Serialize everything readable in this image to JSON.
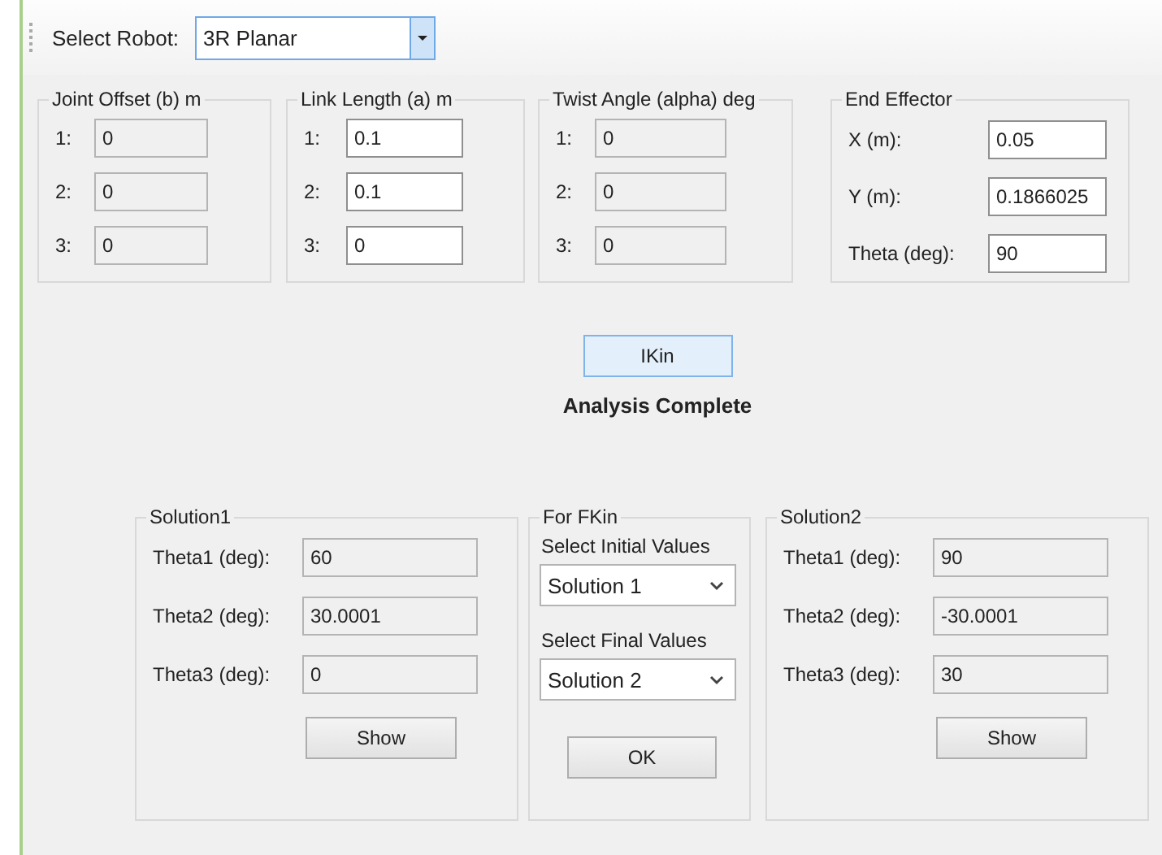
{
  "toolbar": {
    "label": "Select Robot:",
    "robot_select": {
      "value": "3R Planar"
    }
  },
  "parameter_groups": [
    {
      "title": "Joint Offset (b) m",
      "rows": [
        {
          "label": "1:",
          "value": "0",
          "disabled": true
        },
        {
          "label": "2:",
          "value": "0",
          "disabled": true
        },
        {
          "label": "3:",
          "value": "0",
          "disabled": true
        }
      ]
    },
    {
      "title": "Link Length (a) m",
      "rows": [
        {
          "label": "1:",
          "value": "0.1",
          "disabled": false
        },
        {
          "label": "2:",
          "value": "0.1",
          "disabled": false
        },
        {
          "label": "3:",
          "value": "0",
          "disabled": false
        }
      ]
    },
    {
      "title": "Twist Angle (alpha) deg",
      "rows": [
        {
          "label": "1:",
          "value": "0",
          "disabled": true
        },
        {
          "label": "2:",
          "value": "0",
          "disabled": true
        },
        {
          "label": "3:",
          "value": "0",
          "disabled": true
        }
      ]
    }
  ],
  "end_effector": {
    "title": "End Effector",
    "rows": [
      {
        "label": "X (m):",
        "value": "0.05"
      },
      {
        "label": "Y (m):",
        "value": "0.1866025"
      },
      {
        "label": "Theta (deg):",
        "value": "90"
      }
    ]
  },
  "ikin_button": {
    "label": "IKin"
  },
  "status": "Analysis Complete",
  "solution1": {
    "title": "Solution1",
    "rows": [
      {
        "label": "Theta1 (deg):",
        "value": "60"
      },
      {
        "label": "Theta2 (deg):",
        "value": "30.0001"
      },
      {
        "label": "Theta3 (deg):",
        "value": "0"
      }
    ],
    "button": "Show"
  },
  "fkin": {
    "title": "For FKin",
    "initial_label": "Select Initial Values",
    "initial_value": "Solution 1",
    "final_label": "Select Final Values",
    "final_value": "Solution 2",
    "button": "OK"
  },
  "solution2": {
    "title": "Solution2",
    "rows": [
      {
        "label": "Theta1 (deg):",
        "value": "90"
      },
      {
        "label": "Theta2 (deg):",
        "value": "-30.0001"
      },
      {
        "label": "Theta3 (deg):",
        "value": "30"
      }
    ],
    "button": "Show"
  }
}
